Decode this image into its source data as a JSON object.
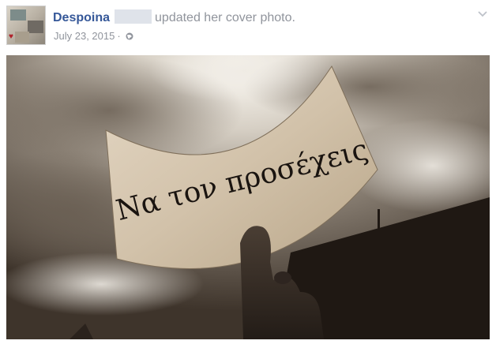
{
  "post": {
    "author_name": "Despoina",
    "action_text": "updated her cover photo.",
    "date": "July 23, 2015",
    "separator": "·",
    "privacy_icon": "globe-icon",
    "menu_icon": "chevron-down-icon"
  },
  "cover_photo": {
    "sign_text": "Να τον προσέχεις"
  },
  "colors": {
    "author_link": "#365899",
    "secondary_text": "#90949c"
  }
}
